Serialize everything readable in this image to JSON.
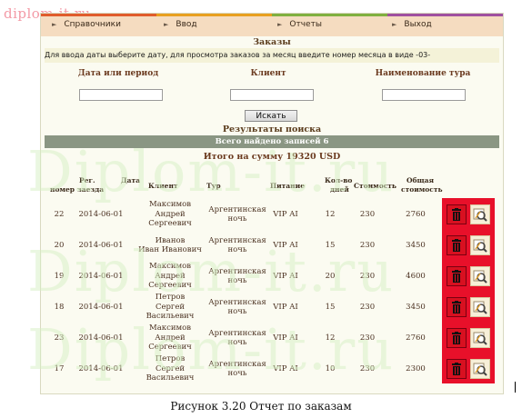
{
  "watermark_small": "diplom-it.ru",
  "watermark_big": "Diplom-it.ru",
  "menu": {
    "items": [
      "Справочники",
      "Ввод",
      "Отчеты",
      "Выход"
    ],
    "stripe_colors": [
      "#e05c2c",
      "#e8a020",
      "#80b040",
      "#a050a0"
    ]
  },
  "orders_title": "Заказы",
  "hint": "Для ввода даты выберите дату, для просмотра заказов за месяц введите номер месяца в виде -03-",
  "filter": {
    "date_label": "Дата или период",
    "client_label": "Клиент",
    "tour_label": "Наименование тура",
    "date_value": "",
    "client_value": "",
    "tour_value": "",
    "search_label": "Искать"
  },
  "results_title": "Результаты поиска",
  "found_text": "Всего найдено записей 6",
  "total_text": "Итого на сумму 19320 USD",
  "table": {
    "headers": {
      "num": "номер",
      "reg": "Рег.",
      "date": "Дата",
      "arrival": "заезда",
      "client": "Клиент",
      "tour": "Тур",
      "food": "Питание",
      "qty": "Кол-во",
      "days": "дней",
      "price": "Стоимость",
      "total1": "Общая",
      "total2": "стоимость"
    },
    "rows": [
      {
        "num": "22",
        "date": "2014-06-01",
        "client": [
          "Максимов",
          "Андрей",
          "Сергеевич"
        ],
        "tour": [
          "Аргентинская",
          "ночь"
        ],
        "food": "VIP AI",
        "days": "12",
        "price": "230",
        "total": "2760"
      },
      {
        "num": "20",
        "date": "2014-06-01",
        "client": [
          "Иванов",
          "Иван Иванович"
        ],
        "tour": [
          "Аргентинская",
          "ночь"
        ],
        "food": "VIP AI",
        "days": "15",
        "price": "230",
        "total": "3450"
      },
      {
        "num": "19",
        "date": "2014-06-01",
        "client": [
          "Максимов",
          "Андрей",
          "Сергеевич"
        ],
        "tour": [
          "Аргентинская",
          "ночь"
        ],
        "food": "VIP AI",
        "days": "20",
        "price": "230",
        "total": "4600"
      },
      {
        "num": "18",
        "date": "2014-06-01",
        "client": [
          "Петров",
          "Сергей",
          "Васильевич"
        ],
        "tour": [
          "Аргентинская",
          "ночь"
        ],
        "food": "VIP AI",
        "days": "15",
        "price": "230",
        "total": "3450"
      },
      {
        "num": "23",
        "date": "2014-06-01",
        "client": [
          "Максимов",
          "Андрей",
          "Сергеевич"
        ],
        "tour": [
          "Аргентинская",
          "ночь"
        ],
        "food": "VIP AI",
        "days": "12",
        "price": "230",
        "total": "2760"
      },
      {
        "num": "17",
        "date": "2014-06-01",
        "client": [
          "Петров",
          "Сергей",
          "Васильевич"
        ],
        "tour": [
          "Аргентинская",
          "ночь"
        ],
        "food": "VIP AI",
        "days": "10",
        "price": "230",
        "total": "2300"
      }
    ],
    "row_actions": [
      "delete-icon",
      "edit-icon"
    ],
    "action_color": "#e8102a"
  },
  "caption": "Рисунок 3.20 Отчет по заказам"
}
